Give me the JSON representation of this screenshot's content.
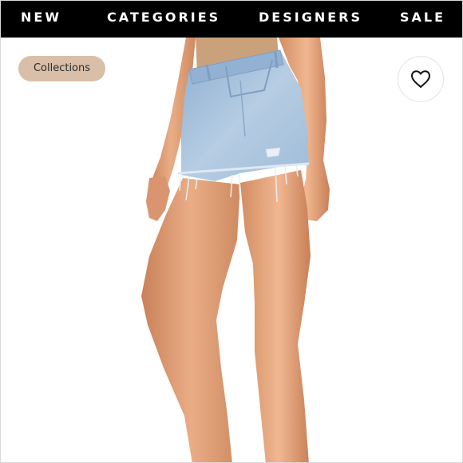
{
  "nav": {
    "items": [
      {
        "label": "NEW"
      },
      {
        "label": "CATEGORIES"
      },
      {
        "label": "DESIGNERS"
      },
      {
        "label": "SALE"
      }
    ]
  },
  "filter_chip": {
    "label": "Collections"
  },
  "favorite": {
    "icon": "heart-outline-icon"
  },
  "product_image": {
    "subject": "light wash denim cutoff shorts on model"
  },
  "colors": {
    "nav_bg": "#000000",
    "nav_text": "#ffffff",
    "chip_bg": "#d9bfa8",
    "denim": "#a9c3dc",
    "skin": "#e0a27a"
  }
}
